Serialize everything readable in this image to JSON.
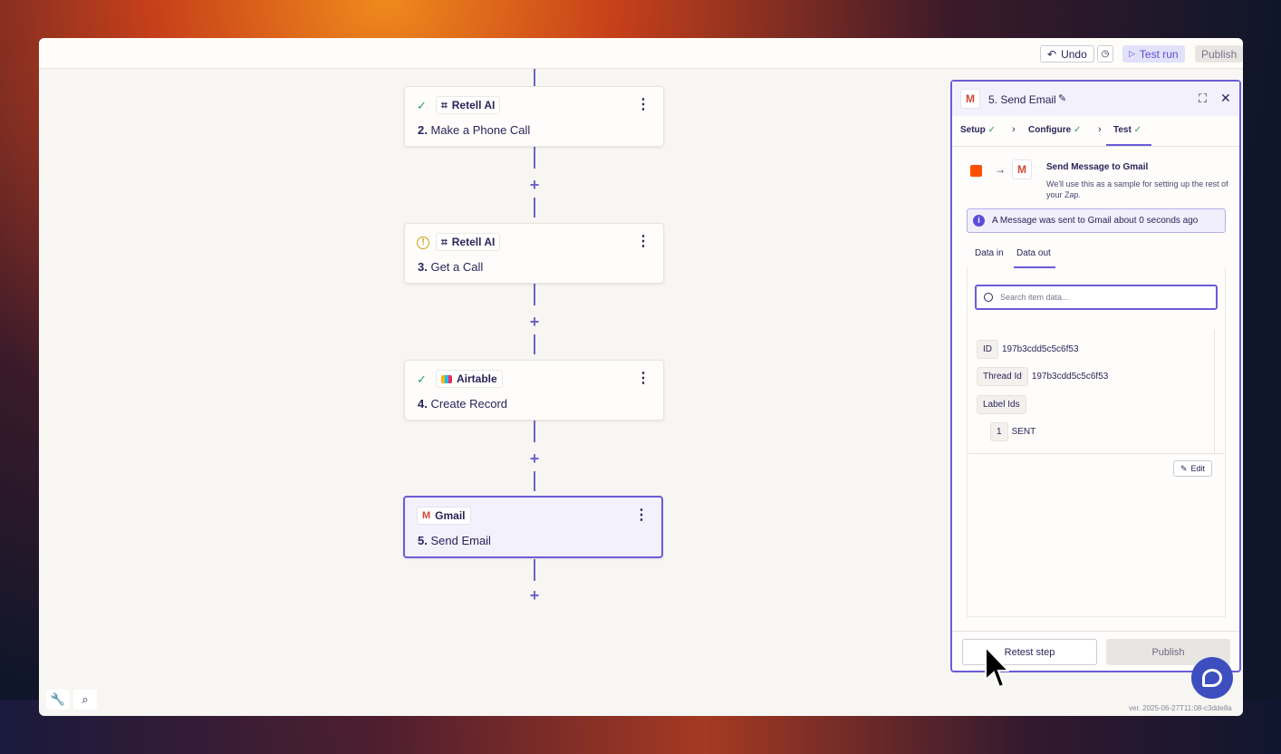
{
  "topbar": {
    "undo_label": "Undo",
    "test_run_label": "Test run",
    "publish_label": "Publish"
  },
  "steps": [
    {
      "app": "Retell AI",
      "number": "2.",
      "name": "Make a Phone Call",
      "status": "check"
    },
    {
      "app": "Retell AI",
      "number": "3.",
      "name": "Get a Call",
      "status": "warning"
    },
    {
      "app": "Airtable",
      "number": "4.",
      "name": "Create Record",
      "status": "check"
    },
    {
      "app": "Gmail",
      "number": "5.",
      "name": "Send Email",
      "status": "none"
    }
  ],
  "panel": {
    "title": "5. Send Email",
    "tabs": [
      "Setup",
      "Configure",
      "Test"
    ],
    "send_title": "Send Message to Gmail",
    "send_subtitle": "We'll use this as a sample for setting up the rest of your Zap.",
    "info_message": "A Message was sent to Gmail about 0 seconds ago",
    "data_tabs": [
      "Data in",
      "Data out"
    ],
    "search_placeholder": "Search item data...",
    "fields": [
      {
        "key": "ID",
        "value": "197b3cdd5c5c6f53"
      },
      {
        "key": "Thread Id",
        "value": "197b3cdd5c5c6f53"
      },
      {
        "key": "Label Ids",
        "value": ""
      },
      {
        "key": "1",
        "value": "SENT"
      }
    ],
    "edit_label": "Edit",
    "retest_label": "Retest step",
    "publish_label": "Publish"
  },
  "version_text": "ver. 2025-06-27T11:08-c3dde8a",
  "colors": {
    "accent": "#6a5cd8",
    "success": "#2e9d5e",
    "zapier_orange": "#ff4f00",
    "chat": "#3d4fbf"
  }
}
